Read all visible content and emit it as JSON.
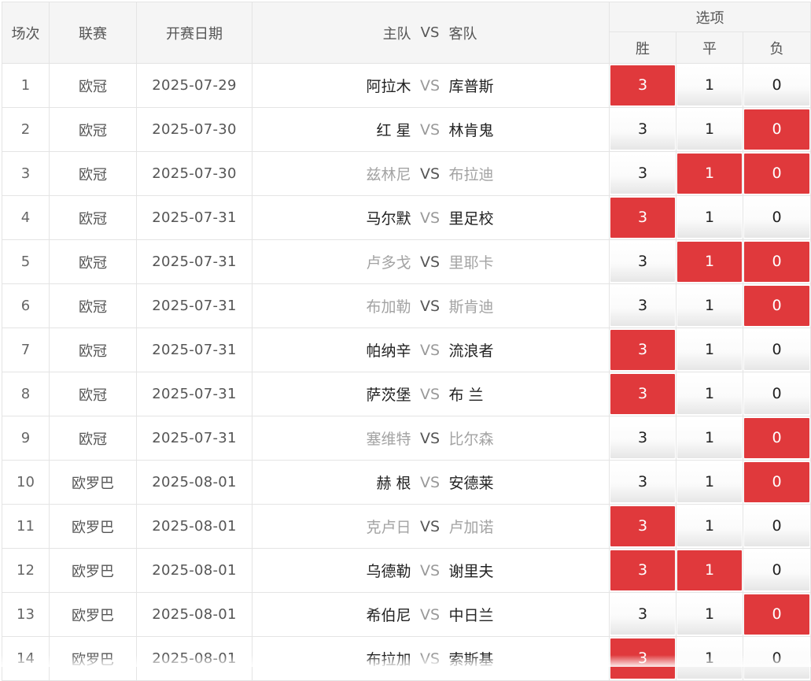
{
  "header": {
    "idx": "场次",
    "league": "联赛",
    "date": "开赛日期",
    "home": "主队",
    "vs": "VS",
    "away": "客队",
    "options": "选项",
    "win": "胜",
    "draw": "平",
    "loss": "负"
  },
  "colors": {
    "selected": "#e0393c",
    "border": "#e4e4e4",
    "header_bg": "#f5f5f5",
    "dim_text": "#a3a3a3"
  },
  "rows": [
    {
      "idx": "1",
      "league": "欧冠",
      "date": "2025-07-29",
      "home": "阿拉木",
      "vs": "VS",
      "away": "库普斯",
      "dim": false,
      "w": "3",
      "d": "1",
      "l": "0",
      "sel": [
        true,
        false,
        false
      ]
    },
    {
      "idx": "2",
      "league": "欧冠",
      "date": "2025-07-30",
      "home": "红 星",
      "vs": "VS",
      "away": "林肯鬼",
      "dim": false,
      "w": "3",
      "d": "1",
      "l": "0",
      "sel": [
        false,
        false,
        true
      ]
    },
    {
      "idx": "3",
      "league": "欧冠",
      "date": "2025-07-30",
      "home": "兹林尼",
      "vs": "VS",
      "away": "布拉迪",
      "dim": true,
      "w": "3",
      "d": "1",
      "l": "0",
      "sel": [
        false,
        true,
        true
      ]
    },
    {
      "idx": "4",
      "league": "欧冠",
      "date": "2025-07-31",
      "home": "马尔默",
      "vs": "VS",
      "away": "里足校",
      "dim": false,
      "w": "3",
      "d": "1",
      "l": "0",
      "sel": [
        true,
        false,
        false
      ]
    },
    {
      "idx": "5",
      "league": "欧冠",
      "date": "2025-07-31",
      "home": "卢多戈",
      "vs": "VS",
      "away": "里耶卡",
      "dim": true,
      "w": "3",
      "d": "1",
      "l": "0",
      "sel": [
        false,
        true,
        true
      ]
    },
    {
      "idx": "6",
      "league": "欧冠",
      "date": "2025-07-31",
      "home": "布加勒",
      "vs": "VS",
      "away": "斯肯迪",
      "dim": true,
      "w": "3",
      "d": "1",
      "l": "0",
      "sel": [
        false,
        false,
        true
      ]
    },
    {
      "idx": "7",
      "league": "欧冠",
      "date": "2025-07-31",
      "home": "帕纳辛",
      "vs": "VS",
      "away": "流浪者",
      "dim": false,
      "w": "3",
      "d": "1",
      "l": "0",
      "sel": [
        true,
        false,
        false
      ]
    },
    {
      "idx": "8",
      "league": "欧冠",
      "date": "2025-07-31",
      "home": "萨茨堡",
      "vs": "VS",
      "away": "布 兰",
      "dim": false,
      "w": "3",
      "d": "1",
      "l": "0",
      "sel": [
        true,
        false,
        false
      ]
    },
    {
      "idx": "9",
      "league": "欧冠",
      "date": "2025-07-31",
      "home": "塞维特",
      "vs": "VS",
      "away": "比尔森",
      "dim": true,
      "w": "3",
      "d": "1",
      "l": "0",
      "sel": [
        false,
        false,
        true
      ]
    },
    {
      "idx": "10",
      "league": "欧罗巴",
      "date": "2025-08-01",
      "home": "赫 根",
      "vs": "VS",
      "away": "安德莱",
      "dim": false,
      "w": "3",
      "d": "1",
      "l": "0",
      "sel": [
        false,
        false,
        true
      ]
    },
    {
      "idx": "11",
      "league": "欧罗巴",
      "date": "2025-08-01",
      "home": "克卢日",
      "vs": "VS",
      "away": "卢加诺",
      "dim": true,
      "w": "3",
      "d": "1",
      "l": "0",
      "sel": [
        true,
        false,
        false
      ]
    },
    {
      "idx": "12",
      "league": "欧罗巴",
      "date": "2025-08-01",
      "home": "乌德勒",
      "vs": "VS",
      "away": "谢里夫",
      "dim": false,
      "w": "3",
      "d": "1",
      "l": "0",
      "sel": [
        true,
        true,
        false
      ]
    },
    {
      "idx": "13",
      "league": "欧罗巴",
      "date": "2025-08-01",
      "home": "希伯尼",
      "vs": "VS",
      "away": "中日兰",
      "dim": false,
      "w": "3",
      "d": "1",
      "l": "0",
      "sel": [
        false,
        false,
        true
      ]
    },
    {
      "idx": "14",
      "league": "欧罗巴",
      "date": "2025-08-01",
      "home": "布拉加",
      "vs": "VS",
      "away": "索斯基",
      "dim": false,
      "w": "3",
      "d": "1",
      "l": "0",
      "sel": [
        true,
        false,
        false
      ]
    }
  ]
}
